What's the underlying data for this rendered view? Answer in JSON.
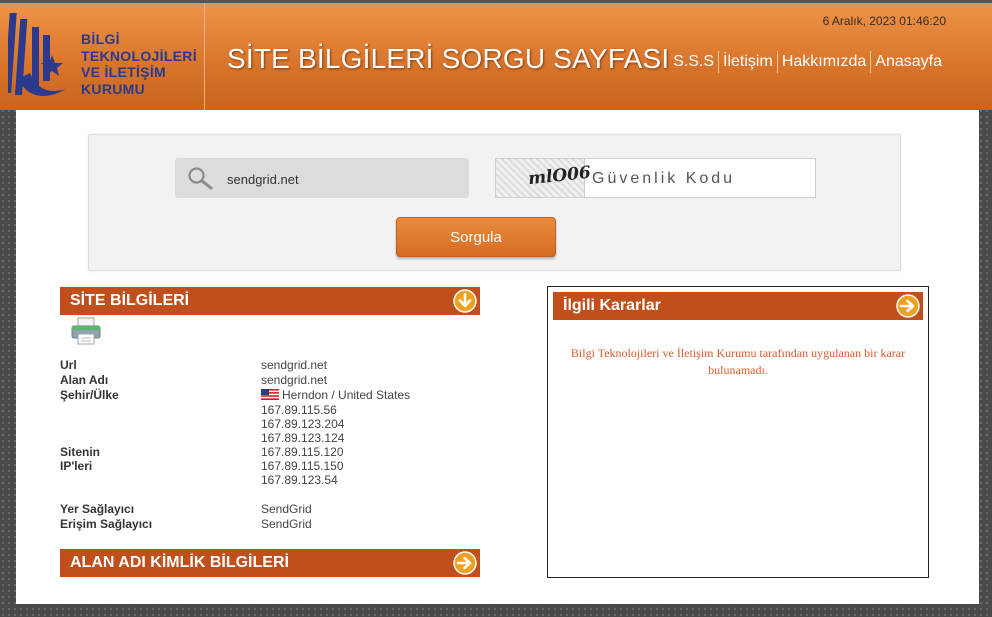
{
  "header": {
    "logo_lines": [
      "BİLGİ",
      "TEKNOLOJİLERİ",
      "VE İLETİŞİM",
      "KURUMU"
    ],
    "title": "SİTE BİLGİLERİ SORGU SAYFASI",
    "datetime": "6 Aralık, 2023 01:46:20",
    "nav": [
      "S.S.S",
      "İletişim",
      "Hakkımızda",
      "Anasayfa"
    ]
  },
  "search": {
    "value": "sendgrid.net",
    "captcha_code": "mlO06",
    "captcha_placeholder": "Güvenlik Kodu",
    "button_label": "Sorgula"
  },
  "site_info": {
    "title": "SİTE BİLGİLERİ",
    "rows": [
      {
        "label": "Url",
        "value": "sendgrid.net"
      },
      {
        "label": "Alan Adı",
        "value": "sendgrid.net"
      },
      {
        "label": "Şehir/Ülke",
        "value": "Herndon / United States"
      }
    ],
    "ip_label": "Sitenin IP'leri",
    "ips": [
      "167.89.115.56",
      "167.89.123.204",
      "167.89.123.124",
      "167.89.115.120",
      "167.89.115.150",
      "167.89.123.54"
    ],
    "providers": [
      {
        "label": "Yer Sağlayıcı",
        "value": "SendGrid"
      },
      {
        "label": "Erişim Sağlayıcı",
        "value": "SendGrid"
      }
    ]
  },
  "domain_identity": {
    "title": "ALAN ADI KİMLİK BİLGİLERİ"
  },
  "related": {
    "title": "İlgili Kararlar",
    "message": "Bilgi Teknolojileri ve İletişim Kurumu tarafından uygulanan bir karar bulunamadı."
  },
  "colors": {
    "header_orange": "#d8732a",
    "section_bar": "#c04f1b",
    "logo_blue": "#2b3a8c",
    "message_text": "#d85a2a"
  }
}
